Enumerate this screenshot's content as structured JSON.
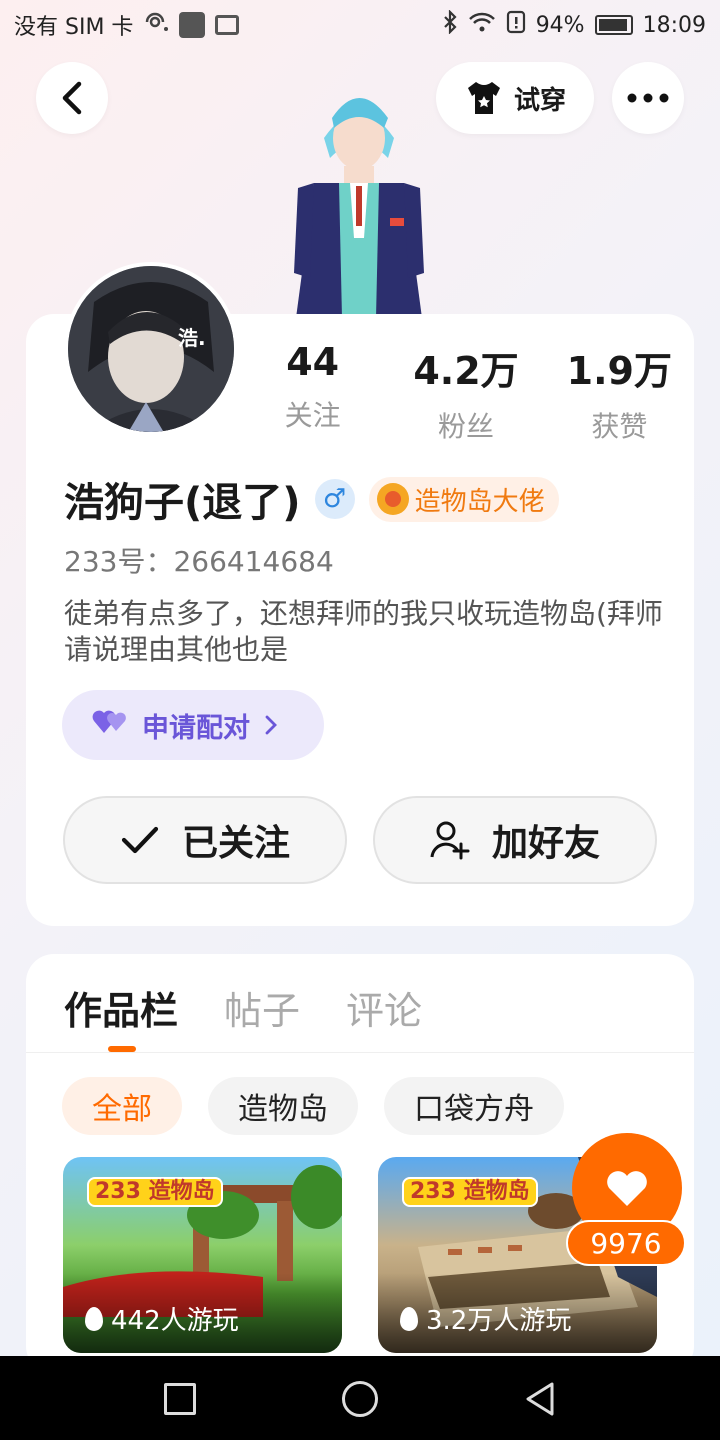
{
  "status_bar": {
    "carrier": "没有 SIM 卡",
    "battery": "94%",
    "time": "18:09"
  },
  "header": {
    "tryon_label": "试穿"
  },
  "profile": {
    "stats": [
      {
        "value": "44",
        "label": "关注"
      },
      {
        "value": "4.2万",
        "label": "粉丝"
      },
      {
        "value": "1.9万",
        "label": "获赞"
      }
    ],
    "username": "浩狗子(退了)",
    "gender_symbol": "♂",
    "title_badge": "造物岛大佬",
    "uid": "233号：266414684",
    "bio": "徒弟有点多了，还想拜师的我只收玩造物岛(拜师请说理由其他也是",
    "pair_label": "申请配对",
    "follow_label": "已关注",
    "add_friend_label": "加好友",
    "avatar_text": "浩."
  },
  "tabs": [
    {
      "label": "作品栏",
      "active": true
    },
    {
      "label": "帖子",
      "active": false
    },
    {
      "label": "评论",
      "active": false
    }
  ],
  "filters": [
    {
      "label": "全部",
      "active": true
    },
    {
      "label": "造物岛",
      "active": false
    },
    {
      "label": "口袋方舟",
      "active": false
    }
  ],
  "games": [
    {
      "logo": "233 造物岛",
      "plays": "442人游玩"
    },
    {
      "logo": "233 造物岛",
      "plays": "3.2万人游玩"
    }
  ],
  "like": {
    "count": "9976"
  },
  "colors": {
    "accent": "#ff6a00",
    "pair": "#6a56d8",
    "gender": "#2e86de"
  }
}
